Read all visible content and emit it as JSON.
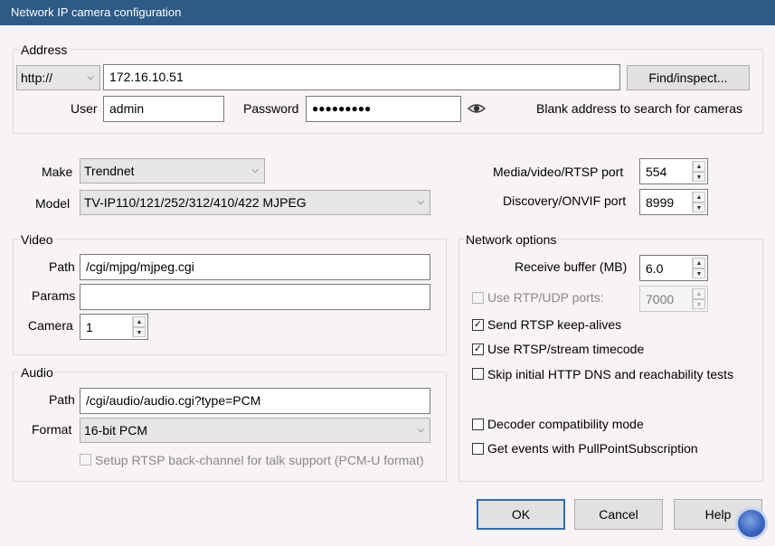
{
  "window": {
    "title": "Network IP camera configuration"
  },
  "address": {
    "group_label": "Address",
    "protocol": "http://",
    "ip": "172.16.10.51",
    "find_button": "Find/inspect...",
    "user_label": "User",
    "user": "admin",
    "password_label": "Password",
    "password_mask": "●●●●●●●●●",
    "hint": "Blank address to search for cameras"
  },
  "camera": {
    "make_label": "Make",
    "make": "Trendnet",
    "model_label": "Model",
    "model": "TV-IP110/121/252/312/410/422 MJPEG"
  },
  "ports": {
    "media_label": "Media/video/RTSP port",
    "media": "554",
    "discovery_label": "Discovery/ONVIF port",
    "discovery": "8999"
  },
  "video": {
    "group_label": "Video",
    "path_label": "Path",
    "path": "/cgi/mjpg/mjpeg.cgi",
    "params_label": "Params",
    "params": "",
    "camera_label": "Camera",
    "camera": "1"
  },
  "audio": {
    "group_label": "Audio",
    "path_label": "Path",
    "path": "/cgi/audio/audio.cgi?type=PCM",
    "format_label": "Format",
    "format": "16-bit PCM",
    "backchannel_label": "Setup RTSP back-channel for talk support (PCM-U format)"
  },
  "network": {
    "group_label": "Network options",
    "buffer_label": "Receive buffer (MB)",
    "buffer": "6.0",
    "rtp_label": "Use RTP/UDP ports:",
    "rtp_port": "7000",
    "keepalive_label": "Send RTSP keep-alives",
    "timecode_label": "Use RTSP/stream timecode",
    "skip_dns_label": "Skip initial HTTP DNS and reachability tests",
    "decoder_label": "Decoder compatibility mode",
    "events_label": "Get events with PullPointSubscription",
    "keepalive_checked": true,
    "timecode_checked": true,
    "skip_dns_checked": false,
    "decoder_checked": false,
    "events_checked": false
  },
  "buttons": {
    "ok": "OK",
    "cancel": "Cancel",
    "help": "Help"
  },
  "icons": {
    "eye": "eye-icon",
    "chevron": "chevron-down-icon",
    "check": "checkmark-icon"
  },
  "colors": {
    "titlebar": "#2e5a88",
    "background": "#f8f3f4",
    "ok_border": "#2f6db3"
  }
}
